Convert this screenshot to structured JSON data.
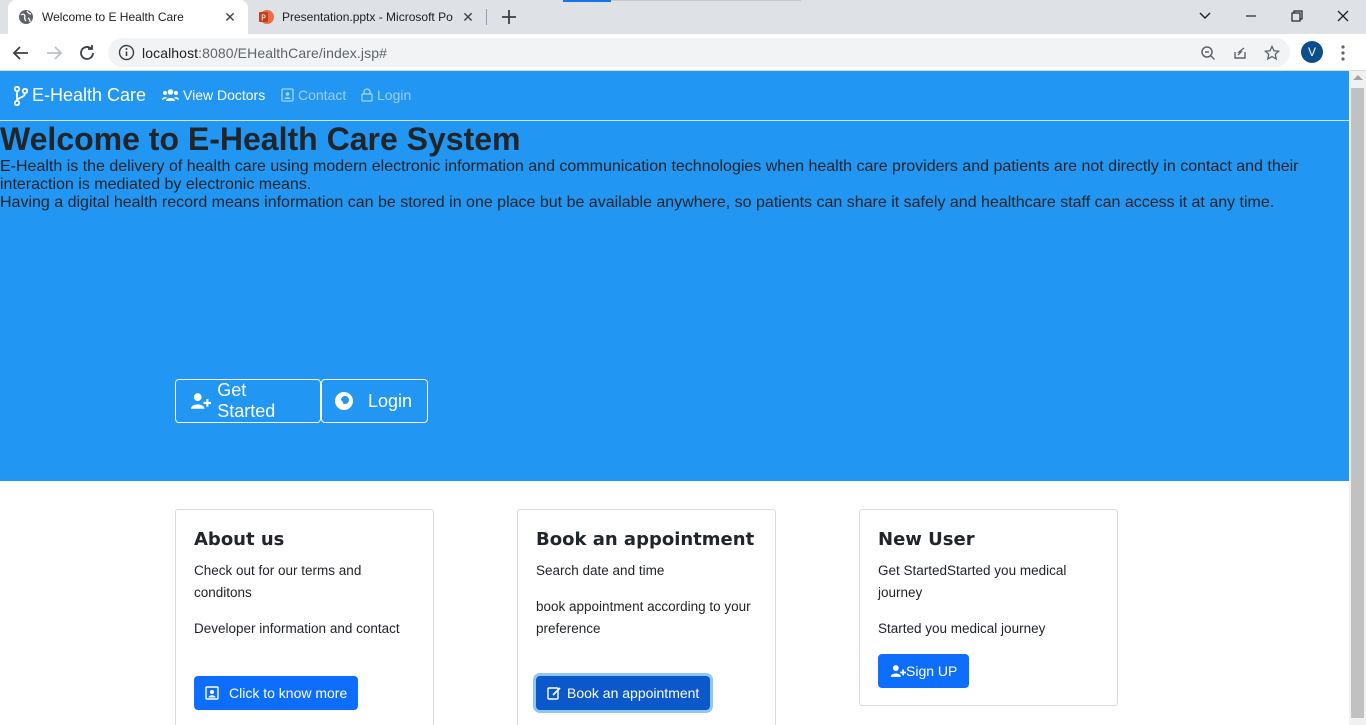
{
  "browser": {
    "tabs": [
      {
        "title": "Welcome to E Health Care",
        "active": true
      },
      {
        "title": "Presentation.pptx - Microsoft Po",
        "active": false
      }
    ],
    "url_host": "localhost",
    "url_path": ":8080/EHealthCare/index.jsp#",
    "profile_initial": "V"
  },
  "nav": {
    "brand": "E-Health Care",
    "links": [
      {
        "label": "View Doctors",
        "icon": "users-icon"
      },
      {
        "label": "Contact",
        "icon": "contact-card-icon"
      },
      {
        "label": "Login",
        "icon": "lock-icon"
      }
    ]
  },
  "hero": {
    "title": "Welcome to E-Health Care System",
    "paragraph1": "E-Health is the delivery of health care using modern electronic information and communication technologies when health care providers and patients are not directly in contact and their interaction is mediated by electronic means.",
    "paragraph2": "Having a digital health record means information can be stored in one place but be available anywhere, so patients can share it safely and healthcare staff can access it at any time.",
    "get_started": "Get Started",
    "login": "Login"
  },
  "cards": [
    {
      "title": "About us",
      "lines": [
        "Check out for our terms and conditons",
        "Developer information and contact"
      ],
      "button": "Click to know more"
    },
    {
      "title": "Book an appointment",
      "lines": [
        "Search date and time",
        "book appointment according to your preference"
      ],
      "button": "Book an appointment"
    },
    {
      "title": "New User",
      "lines": [
        "Get StartedStarted you medical journey",
        "Started you medical journey"
      ],
      "button": "Sign UP"
    }
  ],
  "colors": {
    "primary": "#2196f3",
    "button": "#0d6efd"
  }
}
